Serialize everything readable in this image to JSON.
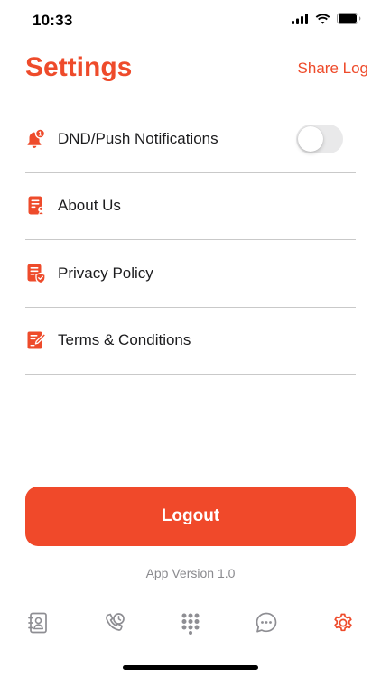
{
  "status": {
    "time": "10:33"
  },
  "header": {
    "title": "Settings",
    "share_log": "Share Log"
  },
  "settings": {
    "items": [
      {
        "label": "DND/Push Notifications",
        "icon": "bell-badge-icon",
        "toggle": false
      },
      {
        "label": "About Us",
        "icon": "document-user-icon"
      },
      {
        "label": "Privacy Policy",
        "icon": "document-shield-icon"
      },
      {
        "label": "Terms & Conditions",
        "icon": "document-edit-icon"
      }
    ]
  },
  "logout": {
    "label": "Logout"
  },
  "footer": {
    "app_version": "App Version 1.0"
  },
  "tabs": [
    {
      "name": "contacts",
      "icon": "contacts-book-icon",
      "active": false
    },
    {
      "name": "call-history",
      "icon": "phone-clock-icon",
      "active": false
    },
    {
      "name": "dialpad",
      "icon": "dialpad-icon",
      "active": false
    },
    {
      "name": "messages",
      "icon": "chat-bubble-icon",
      "active": false
    },
    {
      "name": "settings",
      "icon": "gear-icon",
      "active": true
    }
  ],
  "colors": {
    "accent": "#ee4b2b",
    "inactive_icon": "#8e8e93",
    "toggle_off": "#e9e9ea",
    "divider": "#c9c9c9"
  }
}
